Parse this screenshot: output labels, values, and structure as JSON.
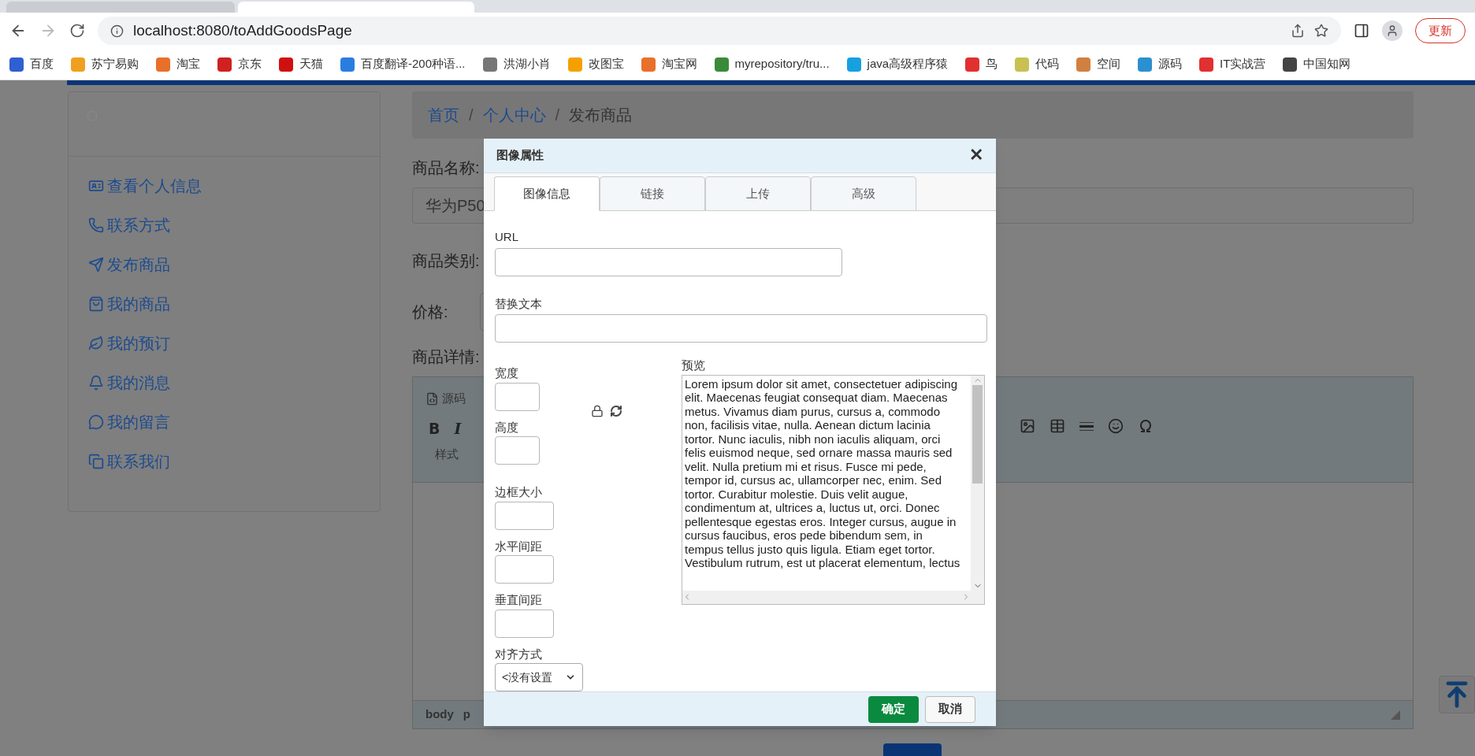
{
  "browser": {
    "url": "localhost:8080/toAddGoodsPage",
    "update_button": "更新",
    "bookmarks": [
      "百度",
      "苏宁易购",
      "淘宝",
      "京东",
      "天猫",
      "百度翻译-200种语...",
      "洪湖小肖",
      "改图宝",
      "淘宝网",
      "myrepository/tru...",
      "java高级程序猿",
      "鸟",
      "代码",
      "空间",
      "源码",
      "IT实战营",
      "中国知网"
    ]
  },
  "sidebar": {
    "items": [
      {
        "label": "查看个人信息"
      },
      {
        "label": "联系方式"
      },
      {
        "label": "发布商品"
      },
      {
        "label": "我的商品"
      },
      {
        "label": "我的预订"
      },
      {
        "label": "我的消息"
      },
      {
        "label": "我的留言"
      },
      {
        "label": "联系我们"
      }
    ]
  },
  "breadcrumb": [
    {
      "label": "首页",
      "kind": "link"
    },
    {
      "label": "/",
      "kind": "separator"
    },
    {
      "label": "个人中心",
      "kind": "link"
    },
    {
      "label": "/",
      "kind": "separator"
    },
    {
      "label": "发布商品",
      "kind": "current"
    }
  ],
  "form": {
    "name_label": "商品名称:",
    "name_value": "华为P50",
    "category_label": "商品类别:",
    "price_label": "价格:",
    "details_label": "商品详情:"
  },
  "editor": {
    "source_button": "源码",
    "bold_button": "B",
    "italic_button": "I",
    "style_dropdown": "样式",
    "path": [
      "body",
      "p"
    ]
  },
  "dialog": {
    "title": "图像属性",
    "close_button": "✕",
    "tabs": [
      {
        "label": "图像信息",
        "selected": true
      },
      {
        "label": "链接",
        "selected": false
      },
      {
        "label": "上传",
        "selected": false
      },
      {
        "label": "高级",
        "selected": false
      }
    ],
    "url_label": "URL",
    "alt_label": "替换文本",
    "size_fields": [
      {
        "label": "宽度"
      },
      {
        "label": "高度"
      }
    ],
    "spacing_fields": [
      {
        "label": "边框大小"
      },
      {
        "label": "水平间距"
      },
      {
        "label": "垂直间距"
      }
    ],
    "align_label": "对齐方式",
    "align_value": "<没有设置",
    "preview_label": "预览",
    "preview_text": "Lorem ipsum dolor sit amet, consectetuer adipiscing elit. Maecenas feugiat consequat diam. Maecenas metus. Vivamus diam purus, cursus a, commodo non, facilisis vitae, nulla. Aenean dictum lacinia tortor. Nunc iaculis, nibh non iaculis aliquam, orci felis euismod neque, sed ornare massa mauris sed velit. Nulla pretium mi et risus. Fusce mi pede, tempor id, cursus ac, ullamcorper nec, enim. Sed tortor. Curabitur molestie. Duis velit augue, condimentum at, ultrices a, luctus ut, orci. Donec pellentesque egestas eros. Integer cursus, augue in cursus faucibus, eros pede bibendum sem, in tempus tellus justo quis ligula. Etiam eget tortor. Vestibulum rutrum, est ut placerat elementum, lectus",
    "ok_button": "确定",
    "cancel_button": "取消"
  }
}
